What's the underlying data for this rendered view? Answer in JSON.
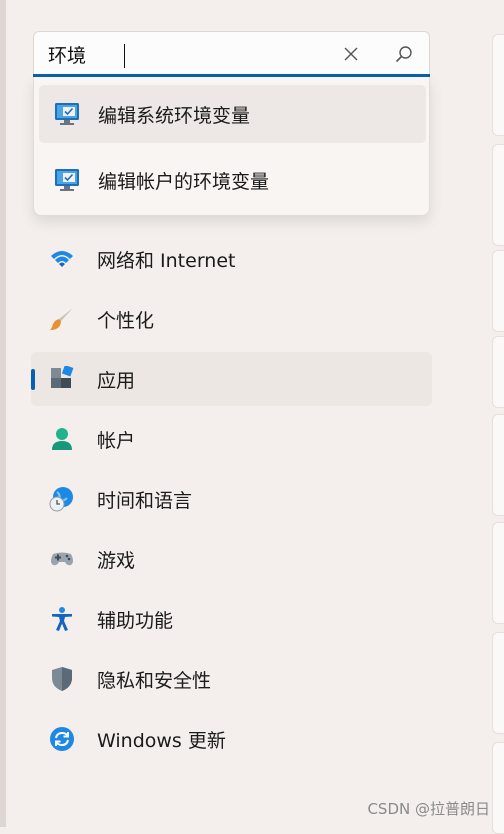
{
  "search": {
    "value": "环境",
    "placeholder": "",
    "clear_icon": "close-icon",
    "search_icon": "search-icon"
  },
  "suggestions": [
    {
      "label": "编辑系统环境变量",
      "icon": "system-properties-icon"
    },
    {
      "label": "编辑帐户的环境变量",
      "icon": "system-properties-icon"
    }
  ],
  "nav": {
    "items": [
      {
        "label": "网络和 Internet",
        "icon": "wifi-icon"
      },
      {
        "label": "个性化",
        "icon": "paintbrush-icon"
      },
      {
        "label": "应用",
        "icon": "apps-icon",
        "selected": true
      },
      {
        "label": "帐户",
        "icon": "account-icon"
      },
      {
        "label": "时间和语言",
        "icon": "globe-clock-icon"
      },
      {
        "label": "游戏",
        "icon": "gamepad-icon"
      },
      {
        "label": "辅助功能",
        "icon": "accessibility-icon"
      },
      {
        "label": "隐私和安全性",
        "icon": "shield-icon"
      },
      {
        "label": "Windows 更新",
        "icon": "update-icon"
      }
    ]
  },
  "watermark": "CSDN @拉普朗日",
  "colors": {
    "accent": "#0a5fb4",
    "background": "#f4efec",
    "selected_bg": "#ede7e3"
  }
}
